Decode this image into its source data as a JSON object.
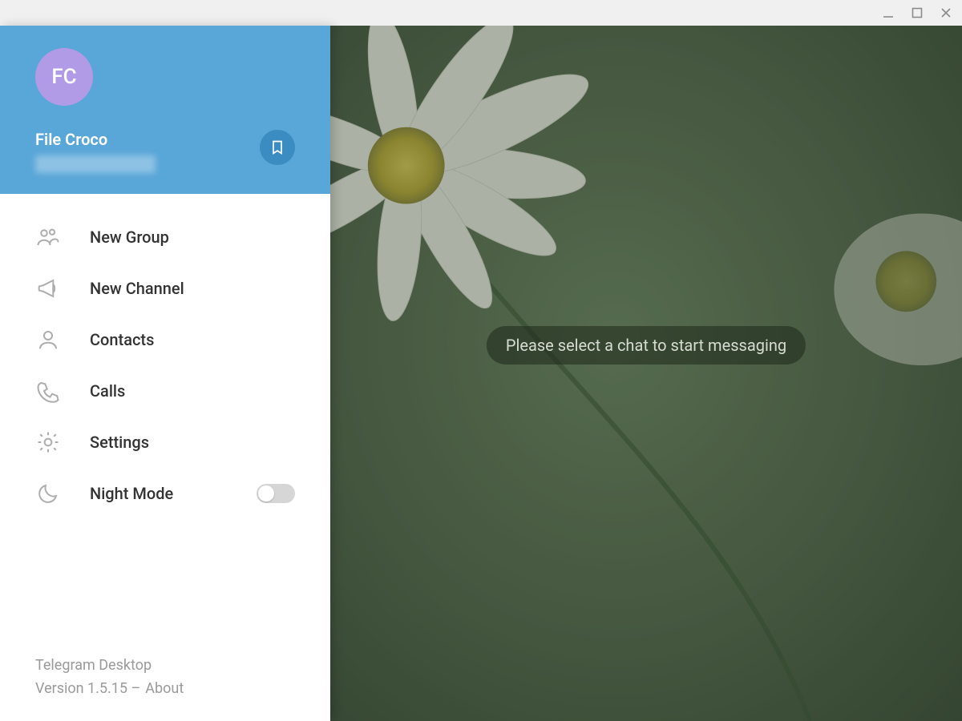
{
  "colors": {
    "header_bg": "#59a6d8",
    "avatar_bg": "#b19be6",
    "bookmark_bg": "#3b8cc0",
    "icon_gray": "#adadad"
  },
  "profile": {
    "initials": "FC",
    "display_name": "File Croco"
  },
  "menu": {
    "items": [
      {
        "label": "New Group"
      },
      {
        "label": "New Channel"
      },
      {
        "label": "Contacts"
      },
      {
        "label": "Calls"
      },
      {
        "label": "Settings"
      },
      {
        "label": "Night Mode"
      }
    ]
  },
  "footer": {
    "app_name": "Telegram Desktop",
    "version_prefix": "Version 1.5.15 – ",
    "about_label": "About"
  },
  "main": {
    "placeholder": "Please select a chat to start messaging"
  }
}
